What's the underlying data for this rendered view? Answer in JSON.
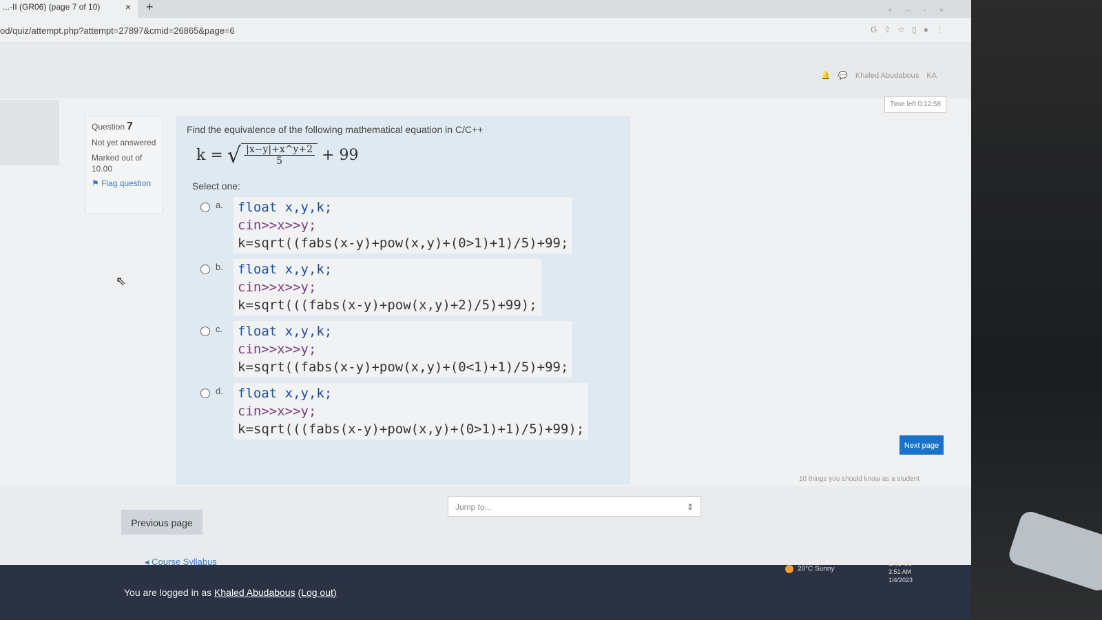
{
  "browser": {
    "tab_title": "...-II (GR06) (page 7 of 10)",
    "tab_close": "×",
    "new_tab": "+",
    "url": "od/quiz/attempt.php?attempt=27897&cmid=26865&page=6"
  },
  "header": {
    "user_name": "Khaled Abudabous",
    "avatar_initials": "KA",
    "timer": "Time left 0:12:58"
  },
  "question_info": {
    "label": "Question",
    "number": "7",
    "status": "Not yet answered",
    "marks": "Marked out of 10.00",
    "flag": "Flag question"
  },
  "question": {
    "text": "Find the equivalence of the following mathematical equation in C/C++",
    "formula_lhs": "k =",
    "formula_num": "|x−y|+x^y+2",
    "formula_den": "5",
    "formula_rhs": "+ 99",
    "select_one": "Select one:"
  },
  "answers": [
    {
      "letter": "a.",
      "line1": "float x,y,k;",
      "line2": "cin>>x>>y;",
      "line3": "k=sqrt((fabs(x-y)+pow(x,y)+(0>1)+1)/5)+99;"
    },
    {
      "letter": "b.",
      "line1": "float x,y,k;",
      "line2": "cin>>x>>y;",
      "line3": "k=sqrt(((fabs(x-y)+pow(x,y)+2)/5)+99);"
    },
    {
      "letter": "c.",
      "line1": "float x,y,k;",
      "line2": "cin>>x>>y;",
      "line3": "k=sqrt((fabs(x-y)+pow(x,y)+(0<1)+1)/5)+99;"
    },
    {
      "letter": "d.",
      "line1": "float x,y,k;",
      "line2": "cin>>x>>y;",
      "line3": "k=sqrt(((fabs(x-y)+pow(x,y)+(0>1)+1)/5)+99);"
    }
  ],
  "nav": {
    "next": "Next page",
    "previous": "Previous page",
    "jump_placeholder": "Jump to...",
    "tips": "10 things you should know as a student",
    "course_syllabus": "Course Syllabus"
  },
  "footer": {
    "logged_in_prefix": "You are logged in as",
    "user": "Khaled Abudabous",
    "logout": "(Log out)"
  },
  "taskbar": {
    "weather": "20°C Sunny",
    "lang": "ENG US",
    "time": "3:51 AM",
    "date": "1/4/2023"
  }
}
